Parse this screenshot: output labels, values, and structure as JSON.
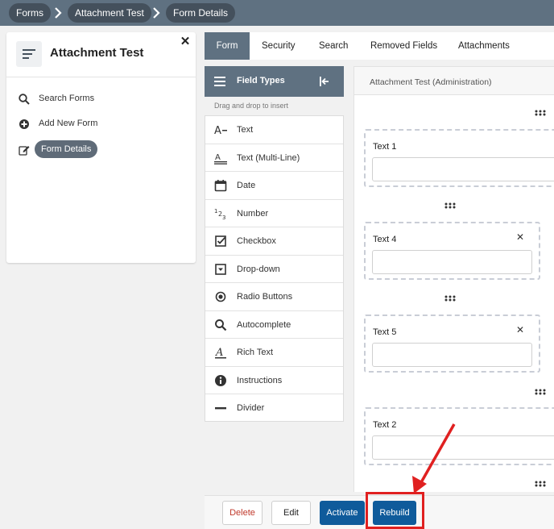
{
  "breadcrumb": [
    "Forms",
    "Attachment Test",
    "Form Details"
  ],
  "sidebar": {
    "title": "Attachment Test",
    "close_label": "✕",
    "items": [
      {
        "label": "Search Forms",
        "icon": "search-icon"
      },
      {
        "label": "Add New Form",
        "icon": "plus-circle-icon"
      },
      {
        "label": "Form Details",
        "icon": "edit-icon",
        "active": true
      }
    ]
  },
  "tabs": [
    {
      "label": "Form",
      "active": true
    },
    {
      "label": "Security"
    },
    {
      "label": "Search"
    },
    {
      "label": "Removed Fields"
    },
    {
      "label": "Attachments"
    }
  ],
  "field_types": {
    "title": "Field Types",
    "hint": "Drag and drop to insert",
    "items": [
      {
        "label": "Text",
        "icon": "text-icon"
      },
      {
        "label": "Text (Multi-Line)",
        "icon": "multiline-text-icon"
      },
      {
        "label": "Date",
        "icon": "calendar-icon"
      },
      {
        "label": "Number",
        "icon": "number-icon"
      },
      {
        "label": "Checkbox",
        "icon": "checkbox-icon"
      },
      {
        "label": "Drop-down",
        "icon": "dropdown-icon"
      },
      {
        "label": "Radio Buttons",
        "icon": "radio-icon"
      },
      {
        "label": "Autocomplete",
        "icon": "search-icon"
      },
      {
        "label": "Rich Text",
        "icon": "rich-text-icon"
      },
      {
        "label": "Instructions",
        "icon": "info-icon"
      },
      {
        "label": "Divider",
        "icon": "divider-icon"
      }
    ]
  },
  "canvas": {
    "title": "Attachment Test (Administration)",
    "fields": [
      {
        "label": "Text 1",
        "removable": false
      },
      {
        "label": "Text 4",
        "removable": true
      },
      {
        "label": "Text 5",
        "removable": true
      },
      {
        "label": "Text 2",
        "removable": false
      }
    ]
  },
  "actions": {
    "delete": "Delete",
    "edit": "Edit",
    "activate": "Activate",
    "rebuild": "Rebuild"
  },
  "colors": {
    "header_bg": "#5f7181",
    "primary_button": "#0f5b9b",
    "delete_text": "#c0392b",
    "annotation": "#e02020"
  }
}
